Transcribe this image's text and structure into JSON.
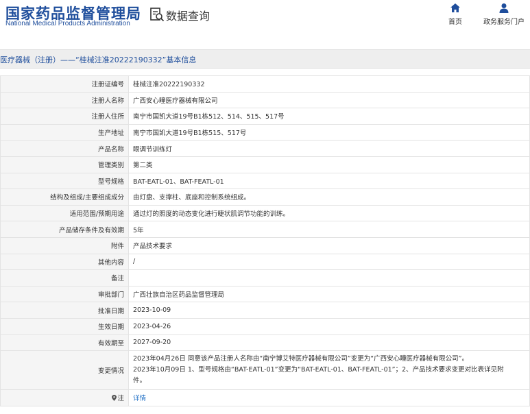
{
  "header": {
    "logo_cn": "国家药品监督管理局",
    "logo_en": "National Medical Products Administration",
    "query_title": "数据查询",
    "nav": [
      {
        "label": "首页",
        "icon": "home-icon"
      },
      {
        "label": "政务服务门户",
        "icon": "user-icon"
      }
    ]
  },
  "title": "医疗器械（注册）——“桂械注准20222190332”基本信息",
  "rows": [
    {
      "label": "注册证编号",
      "value": "桂械注准20222190332"
    },
    {
      "label": "注册人名称",
      "value": "广西安心瞳医疗器械有限公司"
    },
    {
      "label": "注册人住所",
      "value": "南宁市国凯大道19号B1栋512、514、515、517号"
    },
    {
      "label": "生产地址",
      "value": "南宁市国凯大道19号B1栋515、517号"
    },
    {
      "label": "产品名称",
      "value": "眼调节训练灯"
    },
    {
      "label": "管理类别",
      "value": "第二类"
    },
    {
      "label": "型号规格",
      "value": "BAT-EATL-01、BAT-FEATL-01"
    },
    {
      "label": "结构及组成/主要组成成分",
      "value": "由灯盘、支撑柱、底座和控制系统组成。"
    },
    {
      "label": "适用范围/预期用途",
      "value": "通过灯的照度的动态变化进行睫状肌调节功能的训练。"
    },
    {
      "label": "产品储存条件及有效期",
      "value": "5年"
    },
    {
      "label": "附件",
      "value": "产品技术要求"
    },
    {
      "label": "其他内容",
      "value": "/"
    },
    {
      "label": "备注",
      "value": ""
    },
    {
      "label": "审批部门",
      "value": "广西壮族自治区药品监督管理局"
    },
    {
      "label": "批准日期",
      "value": "2023-10-09"
    },
    {
      "label": "生效日期",
      "value": "2023-04-26"
    },
    {
      "label": "有效期至",
      "value": "2027-09-20"
    }
  ],
  "change": {
    "label": "变更情况",
    "line1": "2023年04月26日 同意该产品注册人名称由“南宁博艾特医疗器械有限公司”变更为“广西安心瞳医疗器械有限公司”。",
    "line2": "2023年10月09日 1、型号规格由“BAT-EATL-01”变更为“BAT-EATL-01、BAT-FEATL-01”；2、产品技术要求变更对比表详见附",
    "line3": "件。"
  },
  "note": {
    "label": "注",
    "link": "详情"
  },
  "colors": {
    "brand": "#1f4e9c",
    "link": "#1f6fc5",
    "label_bg": "#f5f5f5",
    "title_bg": "#eeeeee"
  }
}
